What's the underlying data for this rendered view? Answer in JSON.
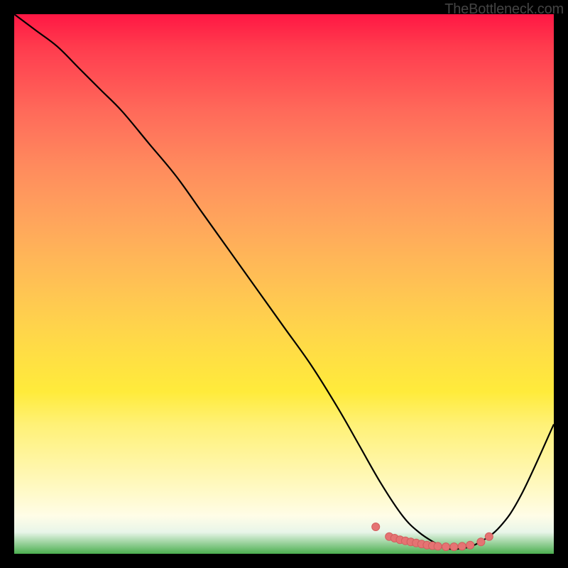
{
  "attribution": "TheBottleneck.com",
  "chart_data": {
    "type": "line",
    "title": "",
    "xlabel": "",
    "ylabel": "",
    "xlim": [
      0,
      100
    ],
    "ylim": [
      0,
      100
    ],
    "series": [
      {
        "name": "bottleneck-curve",
        "x": [
          0,
          4,
          8,
          12,
          16,
          20,
          25,
          30,
          35,
          40,
          45,
          50,
          55,
          60,
          64,
          68,
          72,
          75,
          78,
          80,
          83,
          86,
          90,
          94,
          100
        ],
        "values": [
          100,
          97,
          94,
          90,
          86,
          82,
          76,
          70,
          63,
          56,
          49,
          42,
          35,
          27,
          20,
          13,
          7,
          4,
          2,
          1,
          1,
          2,
          5,
          11,
          24
        ]
      },
      {
        "name": "optimal-range-dots",
        "x": [
          67.0,
          69.5,
          70.5,
          71.5,
          72.5,
          73.5,
          74.5,
          75.5,
          76.5,
          77.5,
          78.5,
          80.0,
          81.5,
          83.0,
          84.5,
          86.5,
          88.0
        ],
        "values": [
          5.0,
          3.2,
          2.9,
          2.6,
          2.4,
          2.2,
          2.0,
          1.8,
          1.6,
          1.5,
          1.4,
          1.3,
          1.3,
          1.4,
          1.6,
          2.2,
          3.2
        ]
      }
    ]
  },
  "colors": {
    "dot": "#e57373",
    "line": "#000000"
  }
}
